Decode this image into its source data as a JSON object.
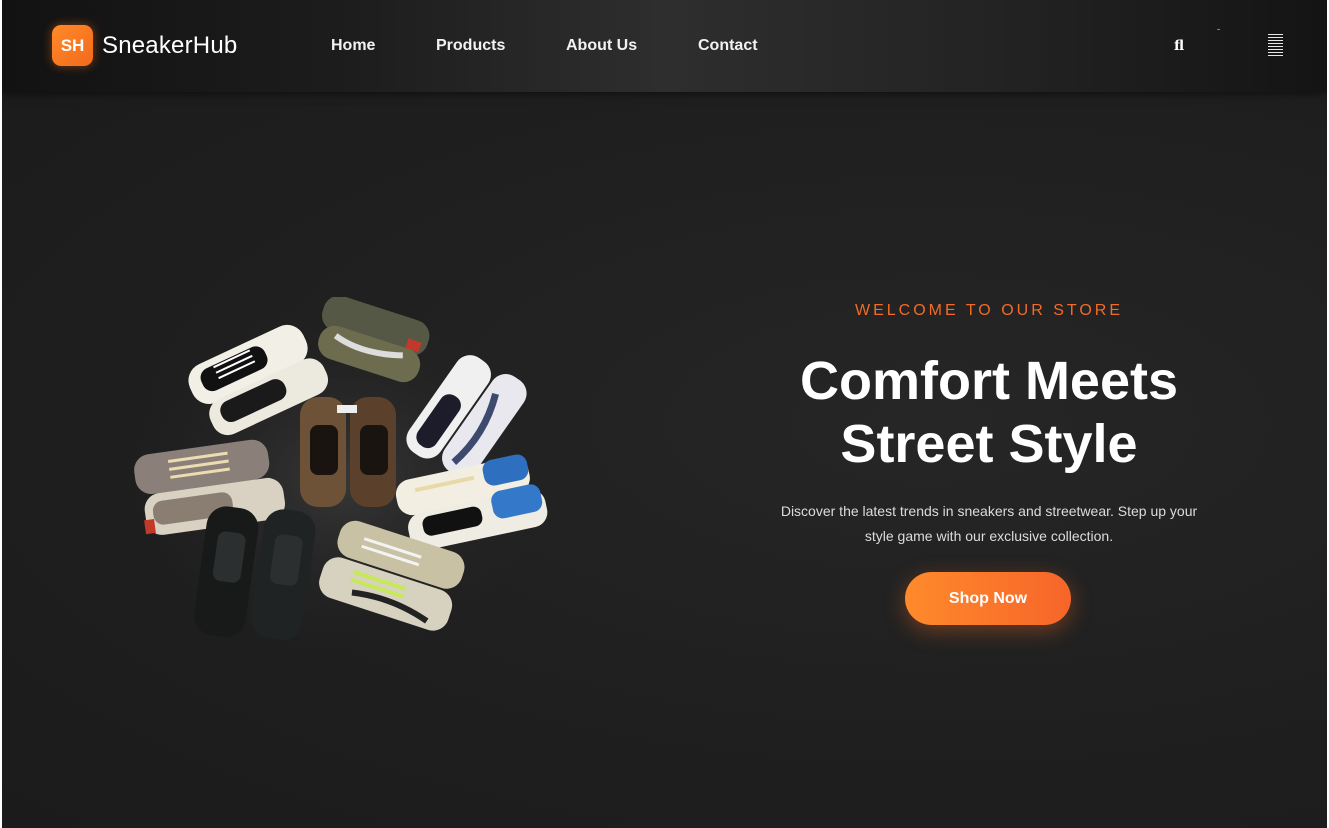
{
  "header": {
    "logo_badge": "SH",
    "brand_name": "SneakerHub",
    "nav": [
      "Home",
      "Products",
      "About Us",
      "Contact"
    ],
    "search_glyph": "fl",
    "accent_color": "#f7792a"
  },
  "hero": {
    "tagline": "WELCOME TO OUR STORE",
    "headline_line1": "Comfort Meets",
    "headline_line2": "Street Style",
    "description": "Discover the latest trends in sneakers and streetwear. Step up your style game with our exclusive collection.",
    "cta_label": "Shop Now",
    "image_icon": "sneaker-collection-photo"
  }
}
